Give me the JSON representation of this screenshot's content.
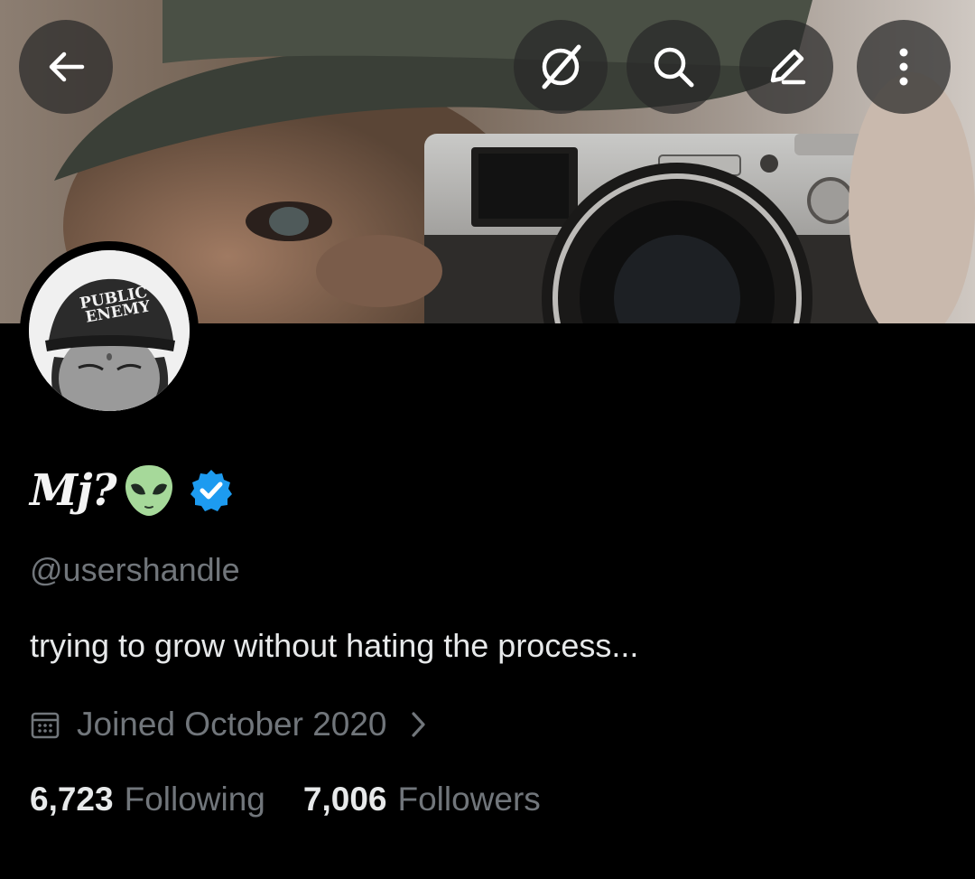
{
  "profile": {
    "display_name": "Mj?",
    "handle": "@usershandle",
    "bio": "trying to grow without hating the process...",
    "joined": "Joined October 2020",
    "verified": true,
    "name_emoji": "alien-emoji",
    "avatar_cap_text_line1": "PUBLIC",
    "avatar_cap_text_line2": "ENEMY"
  },
  "stats": {
    "following_count": "6,723",
    "following_label": "Following",
    "followers_count": "7,006",
    "followers_label": "Followers"
  },
  "header_actions": {
    "back_icon": "arrow-left-icon",
    "grok_icon": "grok-icon",
    "search_icon": "search-icon",
    "edit_icon": "pencil-icon",
    "more_icon": "more-vertical-icon"
  },
  "colors": {
    "background": "#000000",
    "verified_badge": "#1d9bf0",
    "secondary_text": "#71767b",
    "primary_text": "#e7e9ea"
  }
}
